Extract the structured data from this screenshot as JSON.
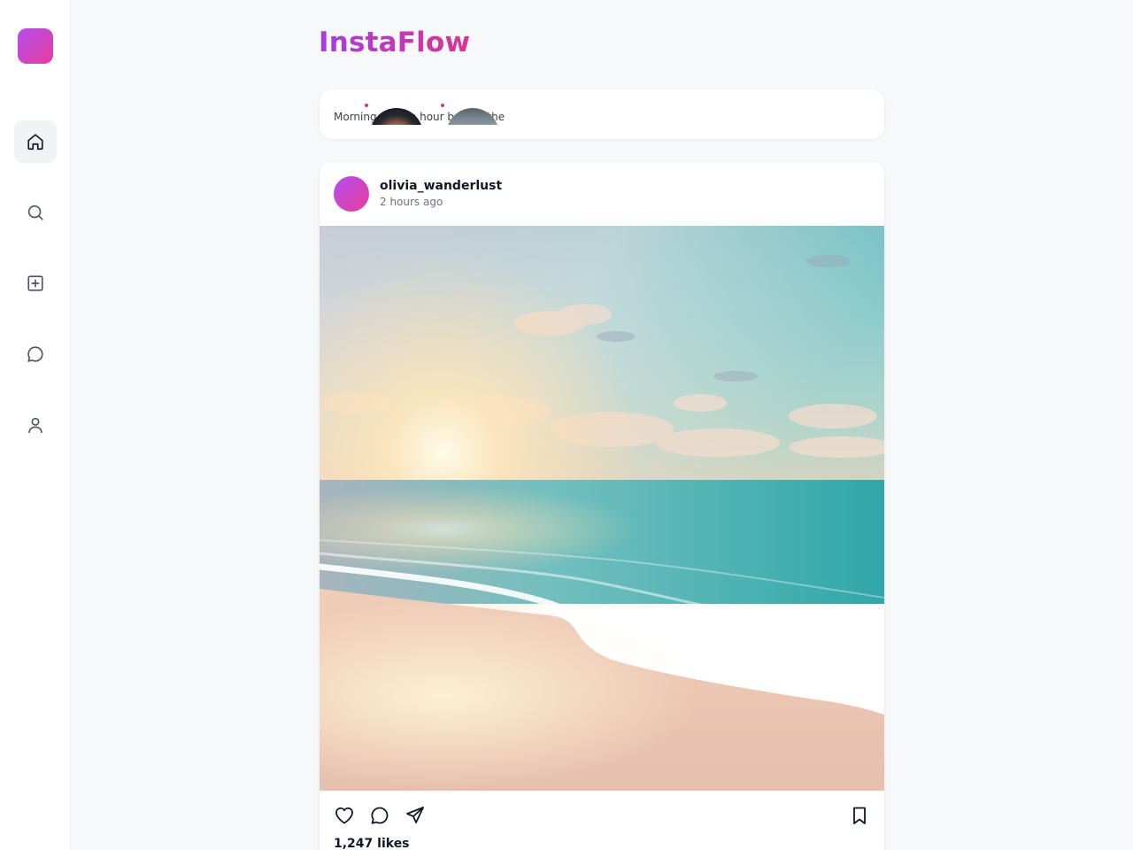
{
  "app": {
    "brand": "InstaFlow",
    "colors": {
      "accent_start": "#b44df0",
      "accent_end": "#e63e9b",
      "story_dot": "#d63384"
    }
  },
  "sidebar": {
    "items": [
      {
        "name": "home",
        "icon": "home-icon",
        "active": true
      },
      {
        "name": "search",
        "icon": "search-icon",
        "active": false
      },
      {
        "name": "create",
        "icon": "plus-square-icon",
        "active": false
      },
      {
        "name": "messages",
        "icon": "chat-bubble-icon",
        "active": false
      },
      {
        "name": "profile",
        "icon": "user-icon",
        "active": false
      }
    ]
  },
  "stories": {
    "caption": "Morning golden hour behind the"
  },
  "post": {
    "username": "olivia_wanderlust",
    "time": "2 hours ago",
    "image_alt": "beach sunset photo",
    "likes": "1,247 likes",
    "actions": [
      "heart-icon",
      "comment-icon",
      "share-icon",
      "bookmark-icon"
    ]
  }
}
